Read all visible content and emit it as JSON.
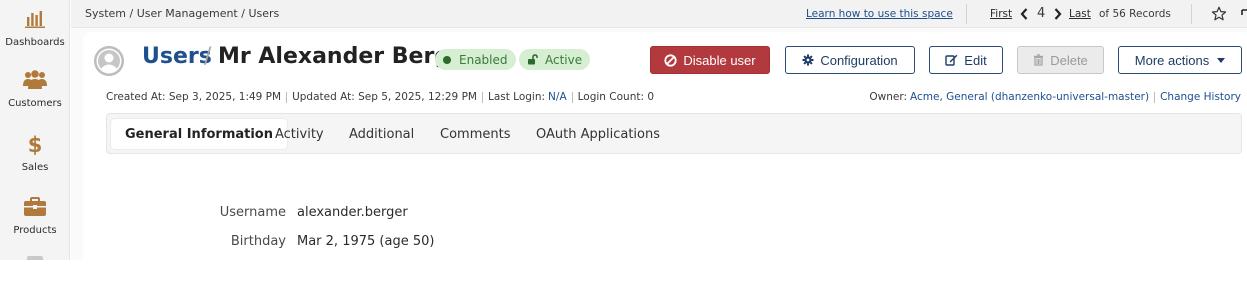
{
  "sidebar": {
    "items": [
      {
        "label": "Dashboards",
        "icon": "bar-chart-icon"
      },
      {
        "label": "Customers",
        "icon": "users-icon"
      },
      {
        "label": "Sales",
        "icon": "dollar-icon"
      },
      {
        "label": "Products",
        "icon": "briefcase-icon"
      }
    ]
  },
  "topbar": {
    "breadcrumb": "System / User Management / Users",
    "learn_link": "Learn how to use this space",
    "pager": {
      "first": "First",
      "current": "4",
      "last": "Last",
      "total": "of 56 Records"
    }
  },
  "header": {
    "section": "Users",
    "slash": "/",
    "name": "Mr Alexander Berger",
    "badges": {
      "enabled": "Enabled",
      "active": "Active"
    }
  },
  "actions": {
    "disable": "Disable user",
    "configuration": "Configuration",
    "edit": "Edit",
    "delete": "Delete",
    "more": "More actions"
  },
  "meta": {
    "created": "Created At: Sep 3, 2025, 1:49 PM",
    "updated": "Updated At: Sep 5, 2025, 12:29 PM",
    "last_login_label": "Last Login:",
    "last_login_value": "N/A",
    "login_count": "Login Count: 0",
    "owner_label": "Owner:",
    "owner_value": "Acme, General (dhanzenko-universal-master)",
    "change_history": "Change History"
  },
  "tabs": [
    "General Information",
    "Activity",
    "Additional",
    "Comments",
    "OAuth Applications"
  ],
  "fields": [
    {
      "label": "Username",
      "value": "alexander.berger"
    },
    {
      "label": "Birthday",
      "value": "Mar 2, 1975 (age 50)"
    }
  ],
  "colors": {
    "brand_link": "#1e4f8f",
    "danger": "#b23a3e",
    "badge_bg": "#d6eed2",
    "badge_text": "#3b7a3b",
    "sidebar_icon": "#b07a3c"
  }
}
